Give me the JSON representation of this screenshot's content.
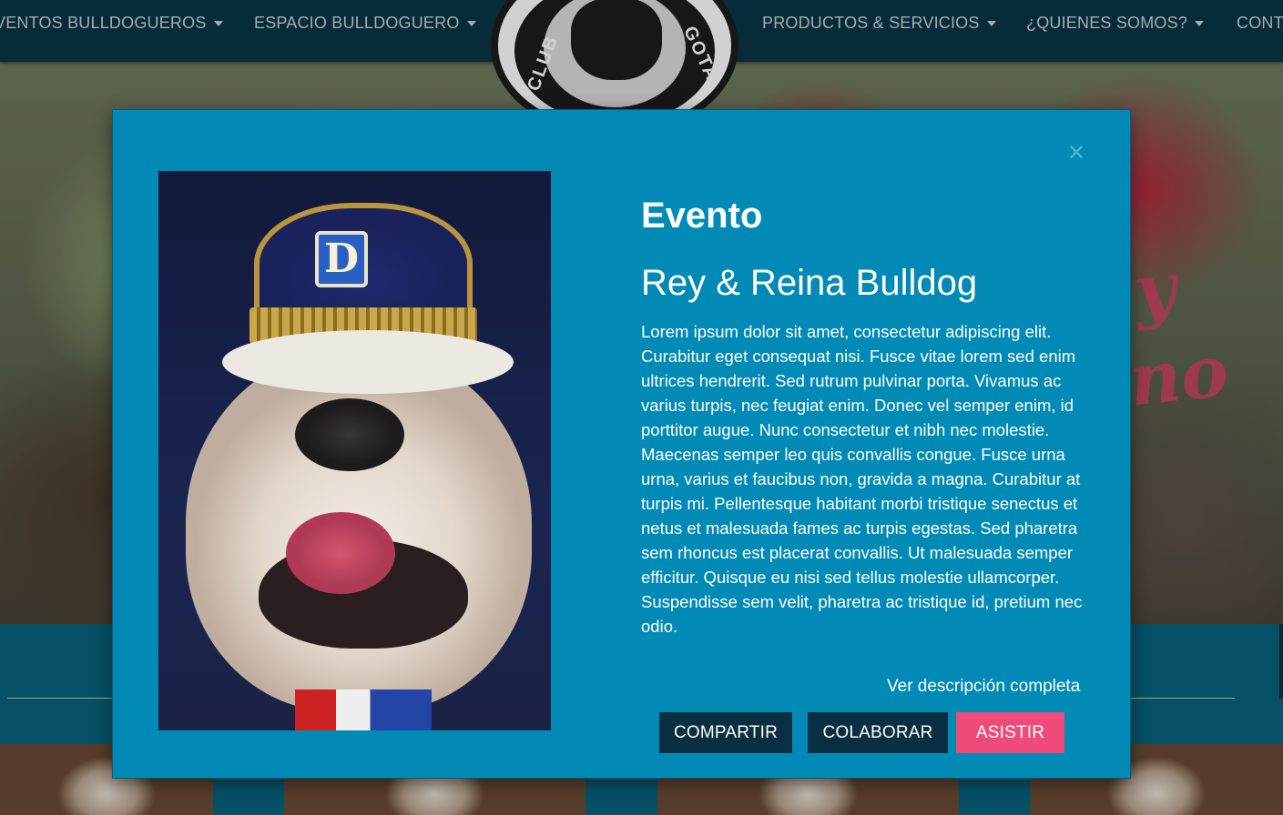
{
  "nav": {
    "items_left": [
      {
        "label": "VENTOS BULLDOGUEROS"
      },
      {
        "label": "ESPACIO BULLDOGUERO"
      }
    ],
    "items_right": [
      {
        "label": "PRODUCTOS & SERVICIOS"
      },
      {
        "label": "¿QUIENES SOMOS?"
      },
      {
        "label": "CONTA"
      }
    ]
  },
  "logo": {
    "text_left": "CLUB",
    "text_right": "GOTA"
  },
  "hero": {
    "script_line1": "y",
    "script_line2": "no"
  },
  "modal": {
    "close_symbol": "×",
    "eyebrow": "Evento",
    "title": "Rey & Reina Bulldog",
    "description": "Lorem ipsum dolor sit amet, consectetur adipiscing elit. Curabitur eget consequat nisi. Fusce vitae lorem sed enim ultrices hendrerit. Sed rutrum pulvinar porta. Vivamus ac varius turpis, nec feugiat enim. Donec vel semper enim, id porttitor augue. Nunc consectetur et nibh nec molestie. Maecenas semper leo quis convallis congue. Fusce urna urna, varius et faucibus non, gravida a magna. Curabitur at turpis mi. Pellentesque habitant morbi tristique senectus et netus et malesuada fames ac turpis egestas. Sed pharetra sem rhoncus est placerat convallis. Ut malesuada semper efficitur. Quisque eu nisi sed tellus molestie ullamcorper. Suspendisse sem velit, pharetra ac tristique id, pretium nec odio.",
    "more_link": "Ver descripción completa",
    "photo_crown_letter": "D",
    "buttons": {
      "share": "COMPARTIR",
      "collaborate": "COLABORAR",
      "attend": "ASISTIR"
    }
  },
  "colors": {
    "nav_bg": "#0a3547",
    "modal_bg": "#028ab6",
    "button_dark": "#0b2f42",
    "button_accent": "#ee4b7a",
    "band": "#07627c"
  }
}
